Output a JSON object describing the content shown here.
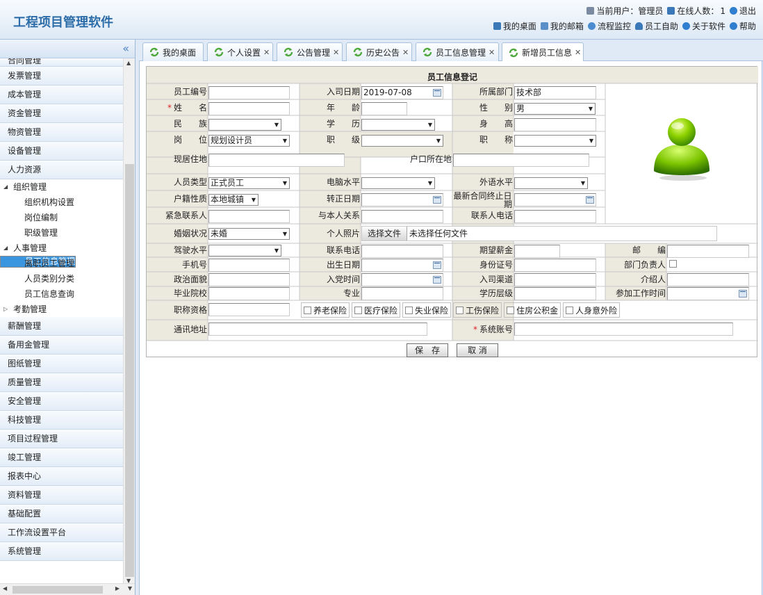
{
  "app": {
    "title": "工程项目管理软件"
  },
  "header": {
    "current_user_label": "当前用户：管理员",
    "online_label": "在线人数：",
    "online_count": "1",
    "logout": "退出",
    "links": [
      "我的桌面",
      "我的邮箱",
      "流程监控",
      "员工自助",
      "关于软件",
      "帮助"
    ]
  },
  "sidebar": {
    "collapse_icon": "double-chevron-left-icon",
    "menu_top": [
      "合同管理",
      "发票管理",
      "成本管理",
      "资金管理",
      "物资管理",
      "设备管理",
      "人力资源"
    ],
    "tree": {
      "org": "组织管理",
      "org_children": [
        "组织机构设置",
        "岗位编制",
        "职级管理"
      ],
      "hr": "人事管理",
      "hr_children": [
        "员工信息管理",
        "离职员工管理",
        "人员类别分类",
        "员工信息查询"
      ],
      "attendance": "考勤管理"
    },
    "menu_bottom": [
      "薪酬管理",
      "备用金管理",
      "图纸管理",
      "质量管理",
      "安全管理",
      "科技管理",
      "项目过程管理",
      "竣工管理",
      "报表中心",
      "资料管理",
      "基础配置",
      "工作流设置平台",
      "系统管理"
    ]
  },
  "tabs": [
    "我的桌面",
    "个人设置",
    "公告管理",
    "历史公告",
    "员工信息管理",
    "新增员工信息"
  ],
  "form": {
    "title": "员工信息登记",
    "labels": {
      "emp_no": "员工编号",
      "join_date": "入司日期",
      "dept": "所属部门",
      "name": "姓　　名",
      "age": "年　　龄",
      "gender": "性　　别",
      "ethnic": "民　　族",
      "education": "学　　历",
      "height": "身　　高",
      "post": "岗　　位",
      "rank": "职　　级",
      "title": "职　　称",
      "address": "现居住地",
      "hukou": "户口所在地",
      "person_type": "人员类型",
      "computer": "电脑水平",
      "language": "外语水平",
      "hukou_type": "户籍性质",
      "regular_date": "转正日期",
      "contract_end_1": "最新合同终止日",
      "contract_end_2": "期",
      "emergency": "紧急联系人",
      "relation": "与本人关系",
      "contact_phone": "联系人电话",
      "marital": "婚姻状况",
      "photo": "个人照片",
      "driving": "驾驶水平",
      "phone": "联系电话",
      "salary": "期望薪金",
      "postcode": "邮　　编",
      "mobile": "手机号",
      "birth": "出生日期",
      "id_no": "身份证号",
      "dept_head": "部门负责人",
      "politics": "政治面貌",
      "party_date": "入党时间",
      "channel": "入司渠道",
      "referrer": "介绍人",
      "school": "毕业院校",
      "major": "专业",
      "edu_level": "学历层级",
      "work_start": "参加工作时间",
      "qualification": "职称资格",
      "mail_address": "通讯地址",
      "account": "系统账号"
    },
    "values": {
      "join_date": "2019-07-08",
      "dept": "技术部",
      "gender": "男",
      "post": "规划设计员",
      "person_type": "正式员工",
      "hukou_type": "本地城镇",
      "marital": "未婚"
    },
    "file_button": "选择文件",
    "file_status": "未选择任何文件",
    "insurance": [
      "养老保险",
      "医疗保险",
      "失业保险",
      "工伤保险",
      "住房公积金",
      "人身意外险"
    ],
    "save": "保　存",
    "cancel": "取 消"
  },
  "colors": {
    "accent": "#3c95df",
    "brand": "#2c6ca8",
    "required": "#dd2222"
  }
}
